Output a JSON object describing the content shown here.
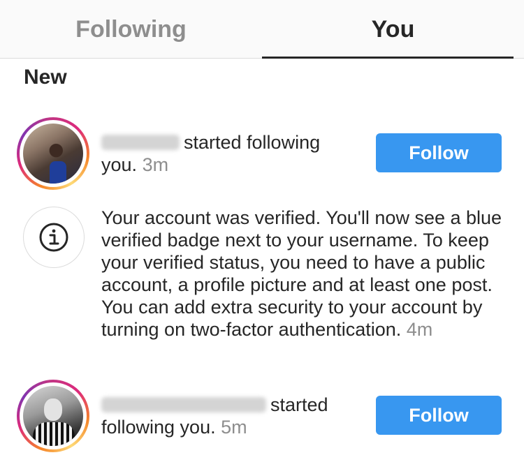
{
  "tabs": [
    {
      "label": "Following",
      "active": false
    },
    {
      "label": "You",
      "active": true
    }
  ],
  "section_title": "New",
  "notifications": [
    {
      "type": "follow",
      "text": "started following you.",
      "time": "3m",
      "button_label": "Follow",
      "avatar_icon": "user-avatar"
    },
    {
      "type": "info",
      "icon": "info-icon",
      "text": "Your account was verified. You'll now see a blue verified badge next to your username. To keep your verified status, you need to have a public account, a profile picture and at least one post. You can add extra security to your account by turning on two-factor authentication.",
      "time": "4m"
    },
    {
      "type": "follow",
      "text": "started following you.",
      "time": "5m",
      "button_label": "Follow",
      "avatar_icon": "user-avatar"
    }
  ],
  "colors": {
    "accent": "#3897f0",
    "text": "#262626",
    "muted": "#8e8e8e",
    "tab_bg": "#fafafa",
    "divider": "#dbdbdb"
  }
}
